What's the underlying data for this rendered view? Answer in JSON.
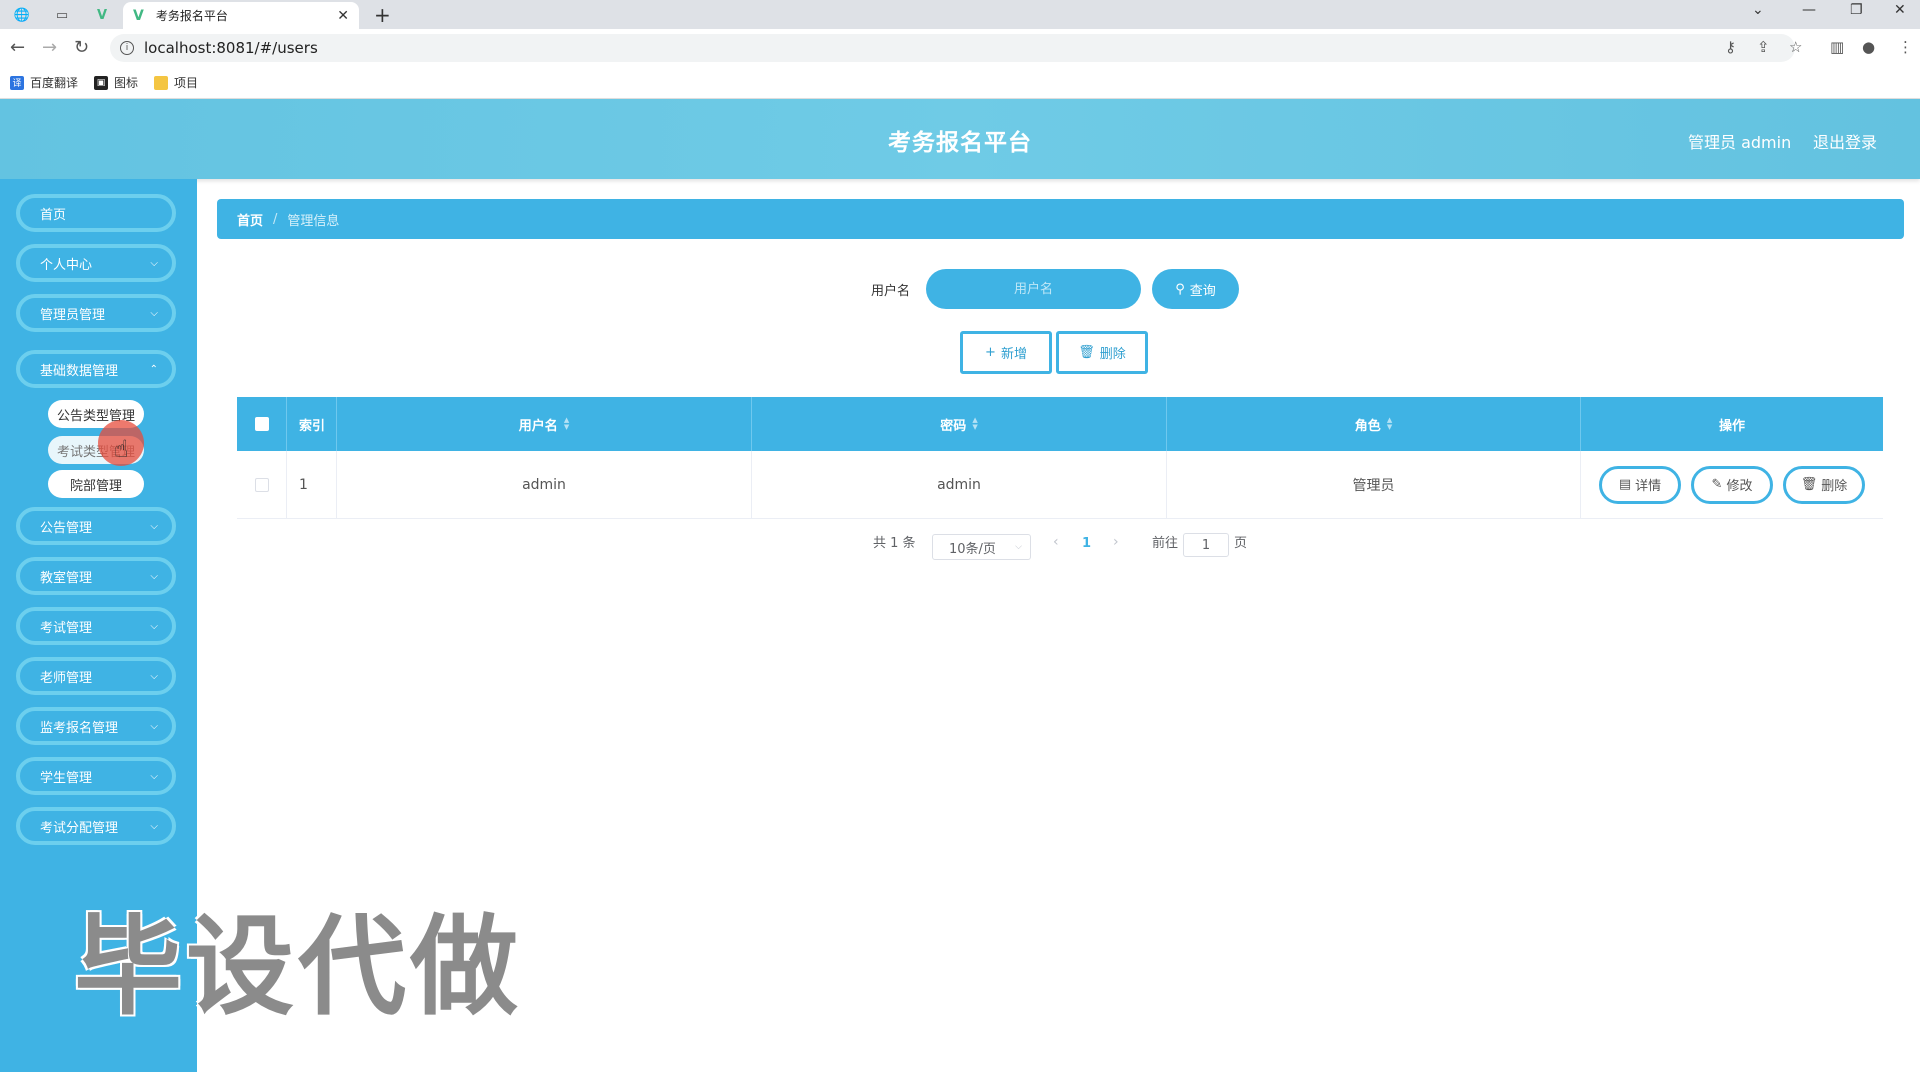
{
  "browser": {
    "tab_title": "考务报名平台",
    "url": "localhost:8081/#/users",
    "bookmarks": [
      "百度翻译",
      "图标",
      "项目"
    ]
  },
  "header": {
    "title": "考务报名平台",
    "user_label": "管理员 admin",
    "logout": "退出登录"
  },
  "sidebar": {
    "items": [
      {
        "label": "首页"
      },
      {
        "label": "个人中心"
      },
      {
        "label": "管理员管理"
      },
      {
        "label": "基础数据管理"
      },
      {
        "label": "公告管理"
      },
      {
        "label": "教室管理"
      },
      {
        "label": "考试管理"
      },
      {
        "label": "老师管理"
      },
      {
        "label": "监考报名管理"
      },
      {
        "label": "学生管理"
      },
      {
        "label": "考试分配管理"
      }
    ],
    "subitems": [
      {
        "label": "公告类型管理"
      },
      {
        "label": "考试类型管理"
      },
      {
        "label": "院部管理"
      }
    ]
  },
  "breadcrumb": {
    "home": "首页",
    "separator": "/",
    "current": "管理信息"
  },
  "search": {
    "label": "用户名",
    "placeholder": "用户名",
    "button": "查询"
  },
  "actions": {
    "add": "新增",
    "delete": "删除"
  },
  "table": {
    "columns": [
      "索引",
      "用户名",
      "密码",
      "角色",
      "操作"
    ],
    "rows": [
      {
        "index": "1",
        "username": "admin",
        "password": "admin",
        "role": "管理员"
      }
    ],
    "row_ops": [
      "详情",
      "修改",
      "删除"
    ]
  },
  "pagination": {
    "total": "共 1 条",
    "page_size": "10条/页",
    "current_page": "1",
    "goto_label": "前往",
    "goto_value": "1",
    "page_unit": "页"
  },
  "watermark": "毕设代做",
  "colors": {
    "primary": "#3fb3e4",
    "header": "#6fcbe6",
    "menu_border": "#6ccfee"
  }
}
